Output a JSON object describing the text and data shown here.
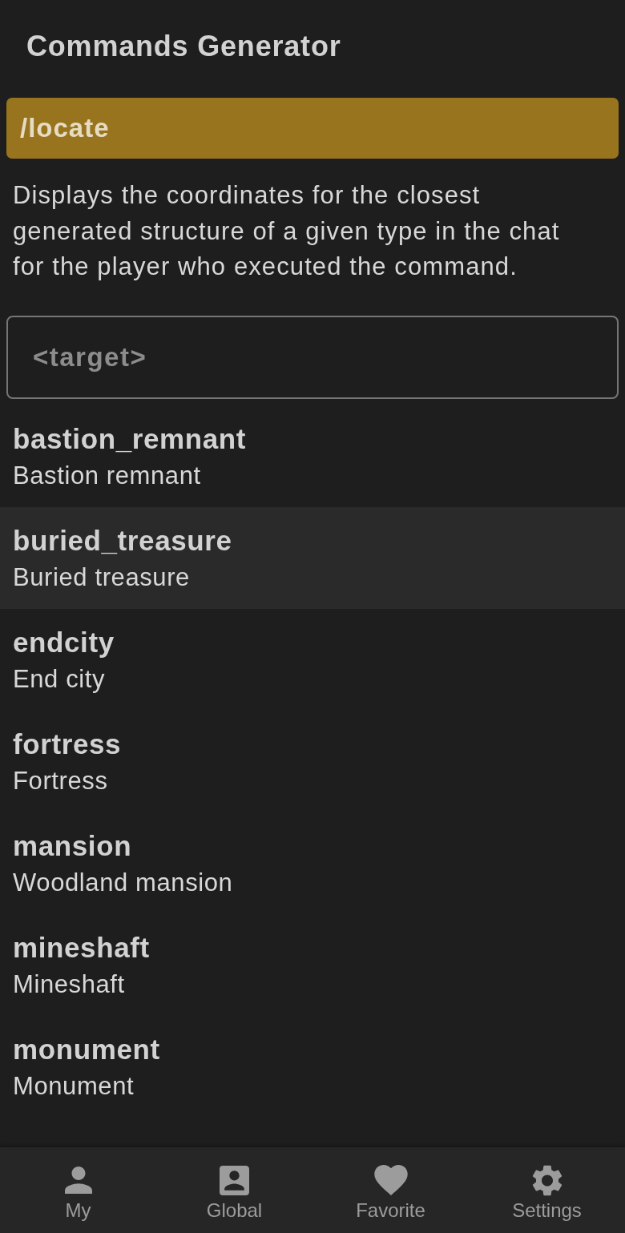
{
  "app_bar": {
    "title": "Commands Generator"
  },
  "command": {
    "label": "/locate",
    "description": "Displays the coordinates for the closest generated structure of a given type in the chat for the player who executed the command."
  },
  "target_field": {
    "placeholder": "<target>"
  },
  "structures": [
    {
      "id": "bastion_remnant",
      "name": "Bastion remnant",
      "selected": false
    },
    {
      "id": "buried_treasure",
      "name": "Buried treasure",
      "selected": true
    },
    {
      "id": "endcity",
      "name": "End city",
      "selected": false
    },
    {
      "id": "fortress",
      "name": "Fortress",
      "selected": false
    },
    {
      "id": "mansion",
      "name": "Woodland mansion",
      "selected": false
    },
    {
      "id": "mineshaft",
      "name": "Mineshaft",
      "selected": false
    },
    {
      "id": "monument",
      "name": "Monument",
      "selected": false
    }
  ],
  "bottom_nav": [
    {
      "label": "My",
      "kind": "person"
    },
    {
      "label": "Global",
      "kind": "contact"
    },
    {
      "label": "Favorite",
      "kind": "heart"
    },
    {
      "label": "Settings",
      "kind": "gear"
    }
  ]
}
